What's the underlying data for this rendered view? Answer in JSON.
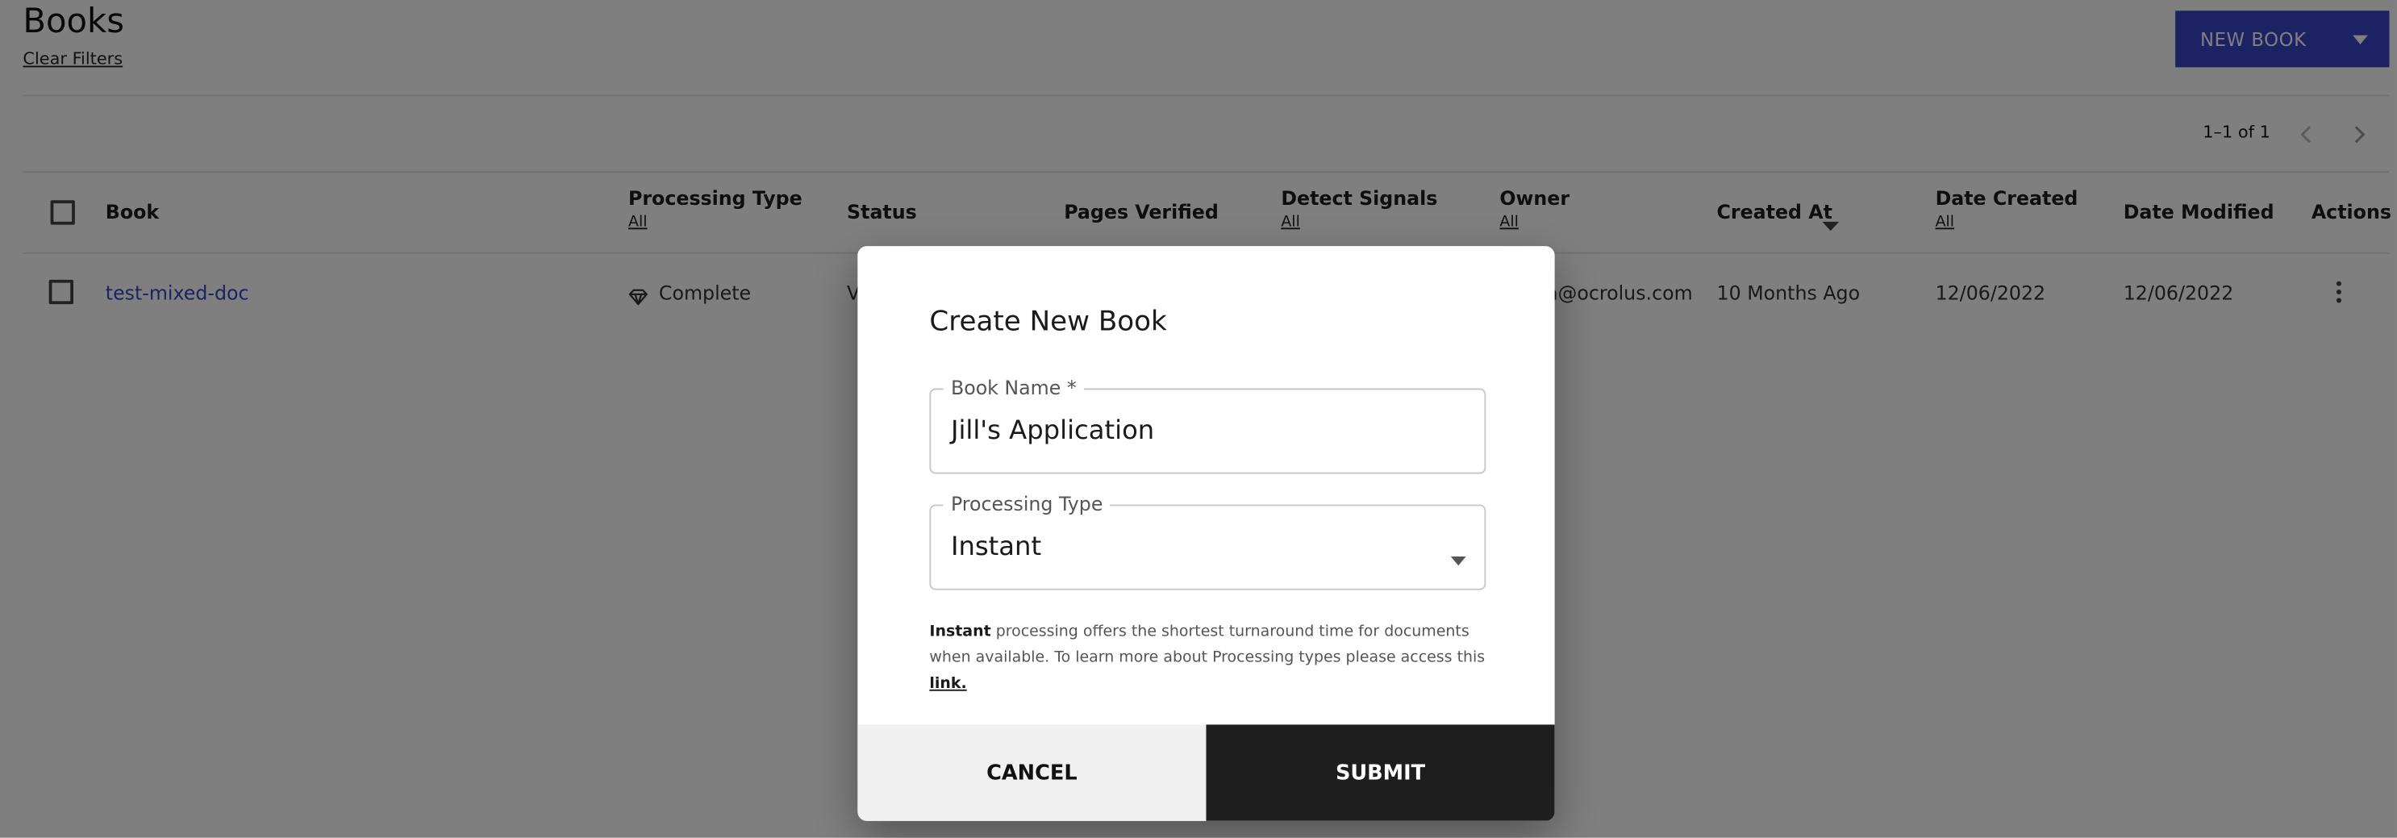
{
  "header": {
    "title": "Books",
    "clear_filters": "Clear Filters",
    "new_book": "NEW BOOK"
  },
  "pagination": {
    "range": "1–1 of 1"
  },
  "table": {
    "columns": {
      "book": "Book",
      "processing_type": "Processing Type",
      "processing_type_filter": "All",
      "status": "Status",
      "pages_verified": "Pages Verified",
      "detect_signals": "Detect Signals",
      "detect_signals_filter": "All",
      "owner": "Owner",
      "owner_filter": "All",
      "created_at": "Created At",
      "date_created": "Date Created",
      "date_created_filter": "All",
      "date_modified": "Date Modified",
      "actions": "Actions"
    },
    "rows": [
      {
        "book": "test-mixed-doc",
        "processing_type": "Complete",
        "status": "V",
        "owner": "la@ocrolus.com",
        "created_at": "10 Months Ago",
        "date_created": "12/06/2022",
        "date_modified": "12/06/2022"
      }
    ]
  },
  "modal": {
    "title": "Create New Book",
    "book_name_label": "Book Name *",
    "book_name_value": "Jill's Application",
    "processing_type_label": "Processing Type",
    "processing_type_value": "Instant",
    "help_bold": "Instant",
    "help_text": " processing offers the shortest turnaround time for documents when available. To learn more about Processing types please access this ",
    "help_link": "link.",
    "cancel": "CANCEL",
    "submit": "SUBMIT"
  },
  "colors": {
    "accent": "#3a44c8",
    "overlay": "rgba(0,0,0,0.5)",
    "submit_bg": "#1e1e1e"
  }
}
